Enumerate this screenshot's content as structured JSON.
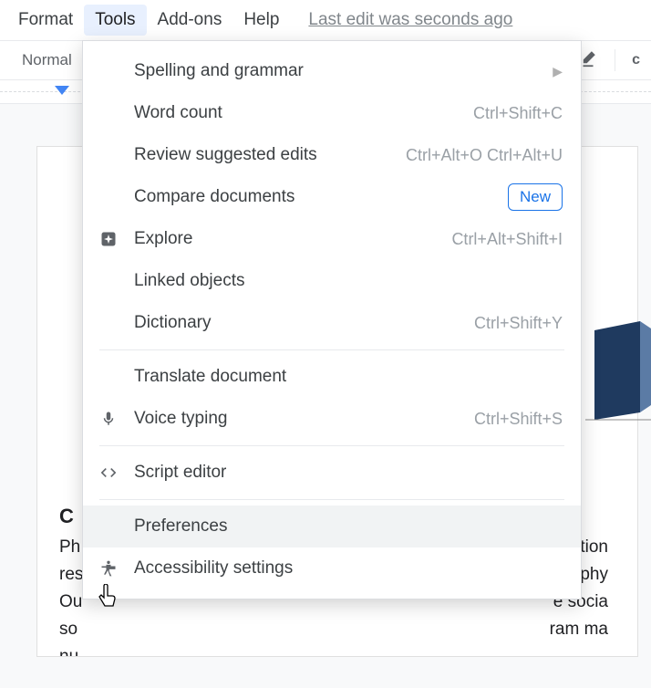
{
  "menubar": {
    "format": "Format",
    "tools": "Tools",
    "addons": "Add-ons",
    "help": "Help",
    "last_edit": "Last edit was seconds ago"
  },
  "toolbar": {
    "style": "Normal"
  },
  "menu": {
    "spelling": {
      "label": "Spelling and grammar"
    },
    "word_count": {
      "label": "Word count",
      "shortcut": "Ctrl+Shift+C"
    },
    "review": {
      "label": "Review suggested edits",
      "shortcut": "Ctrl+Alt+O Ctrl+Alt+U"
    },
    "compare": {
      "label": "Compare documents",
      "badge": "New"
    },
    "explore": {
      "label": "Explore",
      "shortcut": "Ctrl+Alt+Shift+I"
    },
    "linked": {
      "label": "Linked objects"
    },
    "dictionary": {
      "label": "Dictionary",
      "shortcut": "Ctrl+Shift+Y"
    },
    "translate": {
      "label": "Translate document"
    },
    "voice": {
      "label": "Voice typing",
      "shortcut": "Ctrl+Shift+S"
    },
    "script": {
      "label": "Script editor"
    },
    "prefs": {
      "label": "Preferences"
    },
    "a11y": {
      "label": "Accessibility settings"
    }
  },
  "doc": {
    "heading_partial": "C",
    "line1_left": "Ph",
    "line1_right": "edition",
    "line2_left": "res",
    "line2_right": "for phy",
    "line3_left": "Ou",
    "line3_right": "e socia",
    "line4_left": "so",
    "line4_right": "ram ma",
    "line5_left": "nu"
  }
}
